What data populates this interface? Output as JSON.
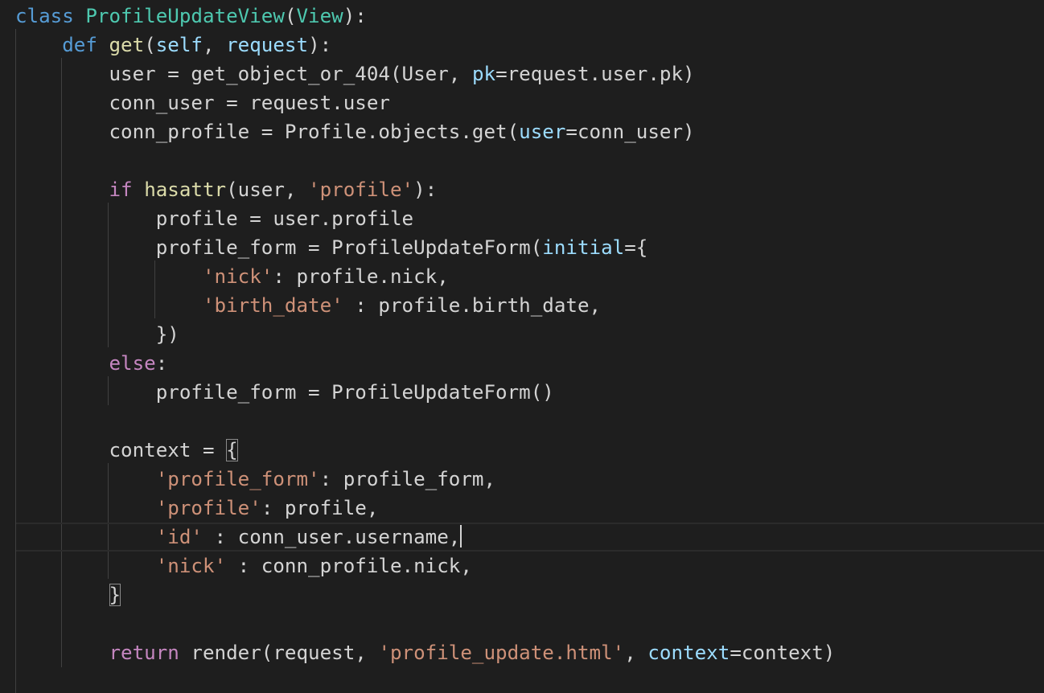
{
  "colors": {
    "background": "#1e1e1e",
    "text": "#d4d4d4",
    "keyword": "#569cd6",
    "control": "#c586c0",
    "class": "#4ec9b0",
    "function": "#dcdcaa",
    "param": "#9cdcfe",
    "string": "#ce9178",
    "guide": "#404040"
  },
  "lines": [
    {
      "tokens": [
        {
          "t": "class",
          "k": "keyword"
        },
        {
          "t": " "
        },
        {
          "t": "ProfileUpdateView",
          "k": "class"
        },
        {
          "t": "("
        },
        {
          "t": "View",
          "k": "class"
        },
        {
          "t": "):"
        }
      ]
    },
    {
      "tokens": [
        {
          "t": "    "
        },
        {
          "t": "def",
          "k": "keyword"
        },
        {
          "t": " "
        },
        {
          "t": "get",
          "k": "function"
        },
        {
          "t": "("
        },
        {
          "t": "self",
          "k": "param"
        },
        {
          "t": ", "
        },
        {
          "t": "request",
          "k": "param"
        },
        {
          "t": "):"
        }
      ]
    },
    {
      "tokens": [
        {
          "t": "        user = get_object_or_404(User, "
        },
        {
          "t": "pk",
          "k": "param"
        },
        {
          "t": "=request.user.pk)"
        }
      ]
    },
    {
      "tokens": [
        {
          "t": "        conn_user = request.user"
        }
      ]
    },
    {
      "tokens": [
        {
          "t": "        conn_profile = Profile.objects.get("
        },
        {
          "t": "user",
          "k": "param"
        },
        {
          "t": "=conn_user)"
        }
      ]
    },
    {
      "tokens": []
    },
    {
      "tokens": [
        {
          "t": "        "
        },
        {
          "t": "if",
          "k": "control"
        },
        {
          "t": " "
        },
        {
          "t": "hasattr",
          "k": "function"
        },
        {
          "t": "(user, "
        },
        {
          "t": "'profile'",
          "k": "string"
        },
        {
          "t": "):"
        }
      ]
    },
    {
      "tokens": [
        {
          "t": "            profile = user.profile"
        }
      ]
    },
    {
      "tokens": [
        {
          "t": "            profile_form = ProfileUpdateForm("
        },
        {
          "t": "initial",
          "k": "param"
        },
        {
          "t": "={"
        }
      ]
    },
    {
      "tokens": [
        {
          "t": "                "
        },
        {
          "t": "'nick'",
          "k": "string"
        },
        {
          "t": ": profile.nick,"
        }
      ]
    },
    {
      "tokens": [
        {
          "t": "                "
        },
        {
          "t": "'birth_date'",
          "k": "string"
        },
        {
          "t": " : profile.birth_date,"
        }
      ]
    },
    {
      "tokens": [
        {
          "t": "            })"
        }
      ]
    },
    {
      "tokens": [
        {
          "t": "        "
        },
        {
          "t": "else",
          "k": "control"
        },
        {
          "t": ":"
        }
      ]
    },
    {
      "tokens": [
        {
          "t": "            profile_form = ProfileUpdateForm()"
        }
      ]
    },
    {
      "tokens": []
    },
    {
      "tokens": [
        {
          "t": "        context = "
        },
        {
          "t": "{",
          "k": "bracket"
        }
      ]
    },
    {
      "tokens": [
        {
          "t": "            "
        },
        {
          "t": "'profile_form'",
          "k": "string"
        },
        {
          "t": ": profile_form,"
        }
      ]
    },
    {
      "tokens": [
        {
          "t": "            "
        },
        {
          "t": "'profile'",
          "k": "string"
        },
        {
          "t": ": profile,"
        }
      ]
    },
    {
      "current": true,
      "tokens": [
        {
          "t": "            "
        },
        {
          "t": "'id'",
          "k": "string"
        },
        {
          "t": " : conn_user.username,"
        },
        {
          "t": "",
          "k": "cursor"
        }
      ]
    },
    {
      "tokens": [
        {
          "t": "            "
        },
        {
          "t": "'nick'",
          "k": "string"
        },
        {
          "t": " : conn_profile.nick,"
        }
      ]
    },
    {
      "tokens": [
        {
          "t": "        "
        },
        {
          "t": "}",
          "k": "bracket"
        }
      ]
    },
    {
      "tokens": []
    },
    {
      "tokens": [
        {
          "t": "        "
        },
        {
          "t": "return",
          "k": "control"
        },
        {
          "t": " render(request, "
        },
        {
          "t": "'profile_update.html'",
          "k": "string"
        },
        {
          "t": ", "
        },
        {
          "t": "context",
          "k": "param"
        },
        {
          "t": "=context)"
        }
      ]
    }
  ]
}
